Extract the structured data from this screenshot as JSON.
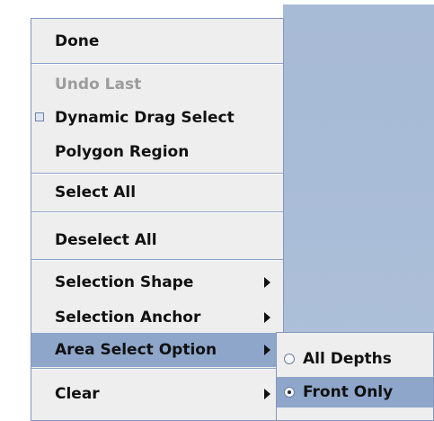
{
  "menu": {
    "items": [
      {
        "label": "Done"
      },
      {
        "label": "Undo Last"
      },
      {
        "label": "Dynamic Drag Select"
      },
      {
        "label": "Polygon Region"
      },
      {
        "label": "Select All"
      },
      {
        "label": "Deselect All"
      },
      {
        "label": "Selection Shape"
      },
      {
        "label": "Selection Anchor"
      },
      {
        "label": "Area Select Option"
      },
      {
        "label": "Clear"
      }
    ],
    "dynamic_drag_select_checked": false
  },
  "submenu": {
    "items": [
      {
        "label": "All Depths",
        "selected": false
      },
      {
        "label": "Front Only",
        "selected": true
      }
    ]
  },
  "colors": {
    "menu_background": "#eeeeee",
    "highlight_background": "#8ea6ca",
    "border": "#8495bd",
    "disabled_text": "#9c9c9c",
    "desktop_background": "#a9bcd7"
  },
  "icons": {
    "checkbox": "checkbox-unchecked-icon",
    "submenu_arrow": "chevron-right-icon",
    "radio_on": "radio-selected-icon",
    "radio_off": "radio-unselected-icon"
  }
}
